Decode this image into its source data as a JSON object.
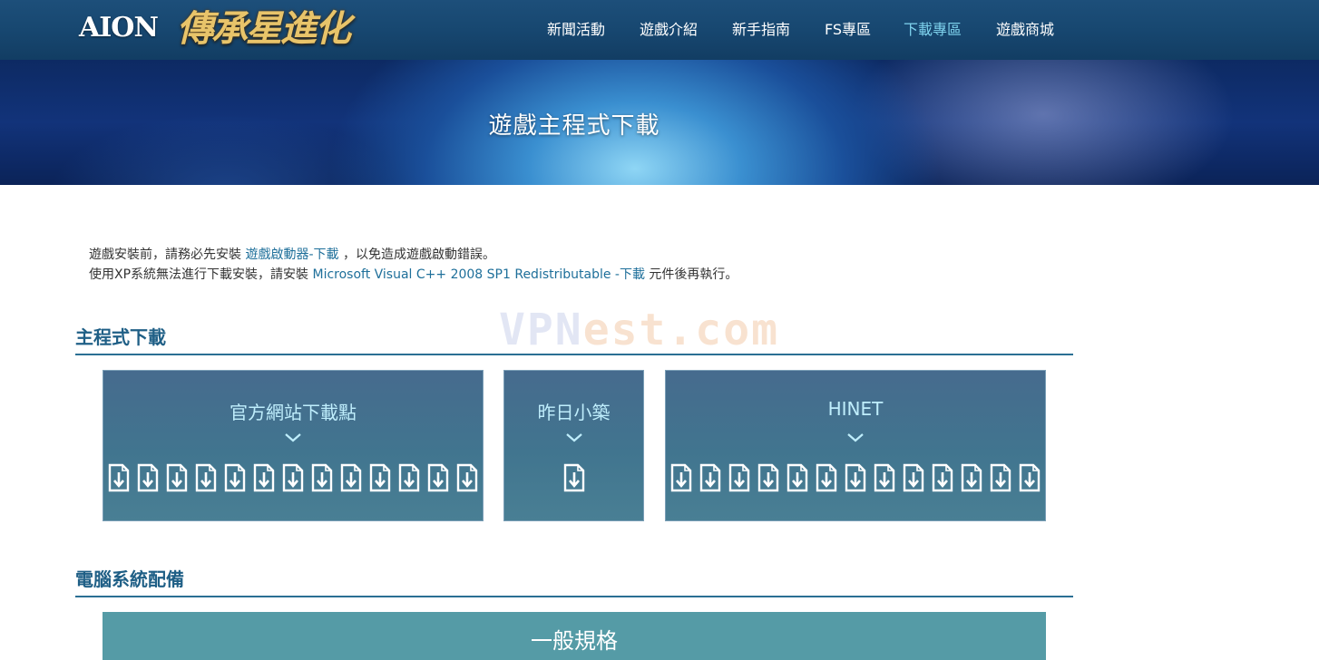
{
  "header": {
    "logo_main": "AION",
    "logo_sub": "傳承星進化",
    "nav": [
      {
        "label": "新聞活動",
        "active": false
      },
      {
        "label": "遊戲介紹",
        "active": false
      },
      {
        "label": "新手指南",
        "active": false
      },
      {
        "label": "FS專區",
        "active": false
      },
      {
        "label": "下載專區",
        "active": true
      },
      {
        "label": "遊戲商城",
        "active": false
      }
    ]
  },
  "banner": {
    "title": "遊戲主程式下載"
  },
  "notes": {
    "line1_prefix": "遊戲安裝前，請務必先安裝 ",
    "line1_link": "遊戲啟動器-下載",
    "line1_suffix": " ，以免造成遊戲啟動錯誤。",
    "line2_prefix": "使用XP系統無法進行下載安裝，請安裝 ",
    "line2_link": "Microsoft Visual C++ 2008 SP1 Redistributable -下載",
    "line2_suffix": " 元件後再執行。"
  },
  "watermark": {
    "part1": "VPN",
    "part2": "est.com"
  },
  "sections": {
    "main_download": "主程式下載",
    "system_requirements": "電腦系統配備"
  },
  "download_boxes": [
    {
      "title": "官方網站下載點",
      "icon_count": 13,
      "icon": "file-download-icon"
    },
    {
      "title": "昨日小築",
      "icon_count": 1,
      "icon": "file-download-icon"
    },
    {
      "title": "HINET",
      "icon_count": 13,
      "icon": "file-download-icon"
    }
  ],
  "spec": {
    "title": "一般規格"
  },
  "colors": {
    "nav_active": "#7fd3ee",
    "link": "#1e6f9a",
    "section_title": "#1f5f86",
    "download_box": "#41758f",
    "spec_bar": "#559ba6"
  }
}
